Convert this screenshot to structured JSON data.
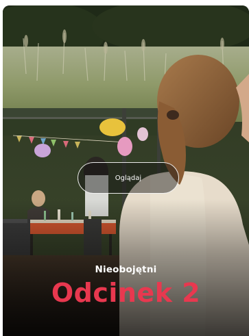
{
  "card": {
    "watch_button_label": "Oglądaj",
    "series_title": "Nieobojętni",
    "episode_title": "Odcinek 2"
  },
  "colors": {
    "episode_title": "#e8384f",
    "button_border": "#ffffff",
    "card_bg": "#1e1c18"
  }
}
